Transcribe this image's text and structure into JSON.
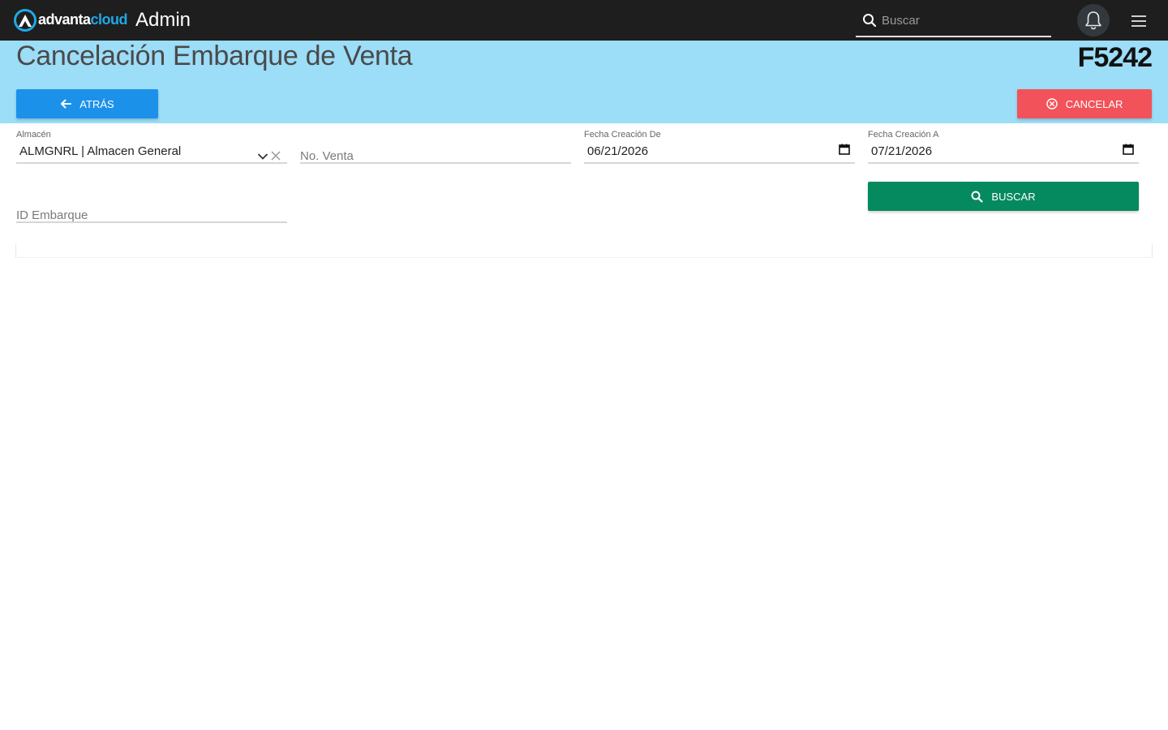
{
  "topbar": {
    "brand_part1": "advanta",
    "brand_part2": "cloud",
    "app_title": "Admin",
    "search_placeholder": "Buscar",
    "icons": [
      "advanta-logo-icon",
      "search-icon",
      "bell-icon",
      "hamburger-menu-icon"
    ]
  },
  "header": {
    "title": "Cancelación Embarque de Venta",
    "code": "F5242",
    "back_label": "ATRÁS",
    "cancel_label": "CANCELAR"
  },
  "form": {
    "almacen": {
      "label": "Almacén",
      "value": "ALMGNRL | Almacen General"
    },
    "no_venta": {
      "placeholder": "No. Venta"
    },
    "fecha_de": {
      "label": "Fecha Creación De",
      "value": "06/21/2026"
    },
    "fecha_a": {
      "label": "Fecha Creación A",
      "value": "07/21/2026"
    },
    "id_embarque": {
      "placeholder": "ID Embarque"
    },
    "search_label": "BUSCAR"
  },
  "colors": {
    "topbar": "#1e1e1e",
    "band": "#9cddf8",
    "back_button": "#1c91ea",
    "cancel_button": "#f2525a",
    "search_button": "#05895e",
    "brand_accent": "#1fa8e6"
  }
}
